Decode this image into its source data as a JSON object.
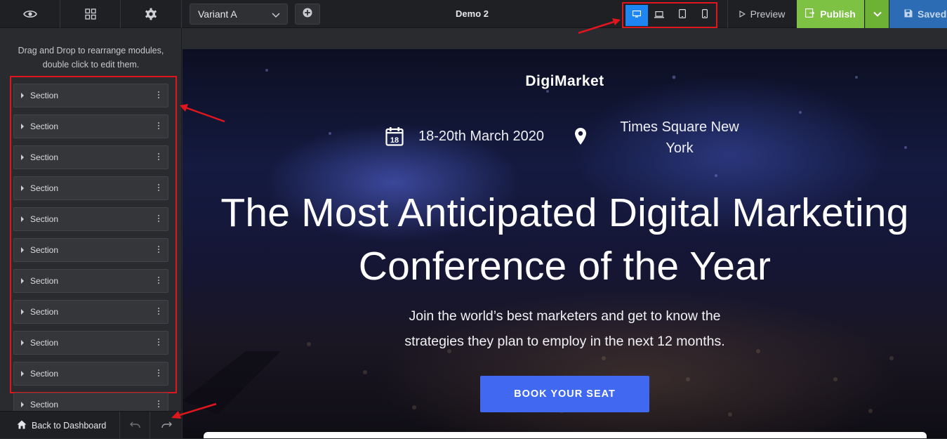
{
  "toolbar": {
    "variant_label": "Variant A",
    "document_title": "Demo 2",
    "preview_label": "Preview",
    "publish_label": "Publish",
    "saved_label": "Saved",
    "icons": [
      "eye-icon",
      "grid-icon",
      "gear-icon",
      "plus-icon",
      "desktop-icon",
      "laptop-icon",
      "tablet-icon",
      "mobile-icon",
      "play-icon",
      "publish-icon",
      "save-icon"
    ],
    "colors": {
      "publish": "#7dc242",
      "saved": "#2b6cb4",
      "active_device": "#1e86f2",
      "highlight": "#e0161f"
    }
  },
  "sidebar": {
    "hint_line1": "Drag and Drop to rearrange modules,",
    "hint_line2": "double click to edit them.",
    "sections": [
      "Section",
      "Section",
      "Section",
      "Section",
      "Section",
      "Section",
      "Section",
      "Section",
      "Section",
      "Section",
      "Section"
    ],
    "back_label": "Back to Dashboard"
  },
  "hero": {
    "brand": "DigiMarket",
    "date": "18-20th March 2020",
    "calendar_number": "18",
    "location_line1": "Times Square New",
    "location_line2": "York",
    "headline_line1": "The Most Anticipated Digital Marketing",
    "headline_line2": "Conference of the Year",
    "sub_line1": "Join the world’s best marketers and get to know the",
    "sub_line2": "strategies they plan to employ in the next 12 months.",
    "cta_label": "BOOK YOUR SEAT",
    "cta_color": "#4168f0"
  }
}
